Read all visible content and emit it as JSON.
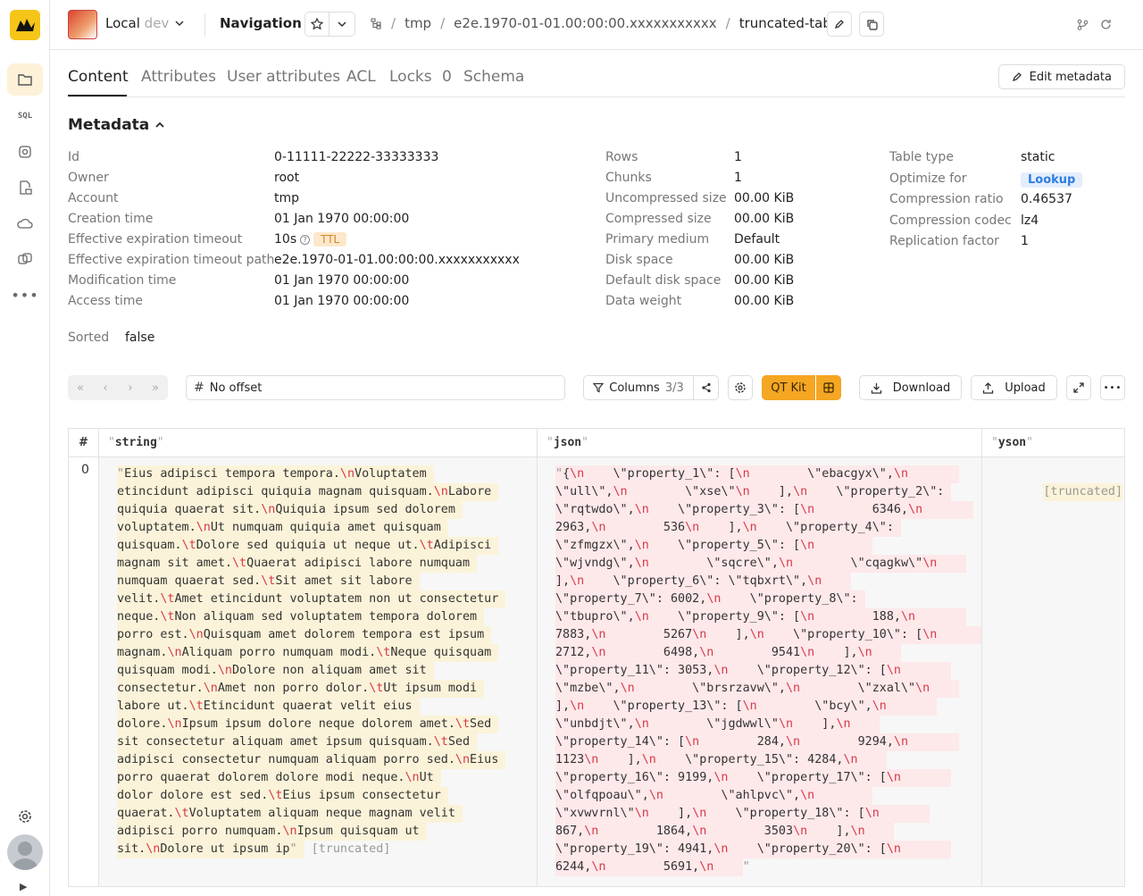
{
  "app": {
    "title": "Navigation"
  },
  "cluster": {
    "name": "Local",
    "env": "dev"
  },
  "breadcrumbs": [
    "tmp",
    "e2e.1970-01-01.00:00:00.xxxxxxxxxxx",
    "truncated-table"
  ],
  "tabs": [
    {
      "label": "Content"
    },
    {
      "label": "Attributes"
    },
    {
      "label": "User attributes"
    },
    {
      "label": "ACL"
    },
    {
      "label": "Locks",
      "count": "0"
    },
    {
      "label": "Schema"
    }
  ],
  "edit_metadata_label": "Edit metadata",
  "metadata": {
    "title": "Metadata",
    "col1": [
      {
        "key": "Id",
        "value": "0-11111-22222-33333333"
      },
      {
        "key": "Owner",
        "value": "root"
      },
      {
        "key": "Account",
        "value": "tmp"
      },
      {
        "key": "Creation time",
        "value": "01 Jan 1970 00:00:00"
      },
      {
        "key": "Effective expiration timeout",
        "value": "10s",
        "badge": "TTL"
      },
      {
        "key": "Effective expiration timeout path",
        "value": "e2e.1970-01-01.00:00:00.xxxxxxxxxxx"
      },
      {
        "key": "Modification time",
        "value": "01 Jan 1970 00:00:00"
      },
      {
        "key": "Access time",
        "value": "01 Jan 1970 00:00:00"
      }
    ],
    "col2": [
      {
        "key": "Rows",
        "value": "1"
      },
      {
        "key": "Chunks",
        "value": "1"
      },
      {
        "key": "Uncompressed size",
        "value": "00.00 KiB"
      },
      {
        "key": "Compressed size",
        "value": "00.00 KiB"
      },
      {
        "key": "Primary medium",
        "value": "Default"
      },
      {
        "key": "Disk space",
        "value": "00.00 KiB"
      },
      {
        "key": "Default disk space",
        "value": "00.00 KiB"
      },
      {
        "key": "Data weight",
        "value": "00.00 KiB"
      }
    ],
    "col3": [
      {
        "key": "Table type",
        "value": "static"
      },
      {
        "key": "Optimize for",
        "value": "Lookup"
      },
      {
        "key": "Compression ratio",
        "value": "0.46537"
      },
      {
        "key": "Compression codec",
        "value": "lz4"
      },
      {
        "key": "Replication factor",
        "value": "1"
      }
    ],
    "sorted": {
      "key": "Sorted",
      "value": "false"
    }
  },
  "toolbar": {
    "offset_label": "No offset",
    "columns_label": "Columns",
    "columns_count": "3/3",
    "qt_kit_label": "QT Kit",
    "download_label": "Download",
    "upload_label": "Upload"
  },
  "table": {
    "columns": [
      "#",
      "string",
      "json",
      "yson"
    ],
    "row_index": "0",
    "string_cell_lines": [
      "Eius adipisci tempora tempora.\\nVoluptatem ",
      "etincidunt adipisci quiquia magnam quisquam.\\nLabore ",
      "quiquia quaerat sit.\\nQuiquia ipsum sed dolorem ",
      "voluptatem.\\nUt numquam quiquia amet quisquam ",
      "quisquam.\\tDolore sed quiquia ut neque ut.\\tAdipisci ",
      "magnam sit amet.\\tQuaerat adipisci labore numquam ",
      "numquam quaerat sed.\\tSit amet sit labore ",
      "velit.\\tAmet etincidunt voluptatem non ut consectetur ",
      "neque.\\tNon aliquam sed voluptatem tempora dolorem ",
      "porro est.\\nQuisquam amet dolorem tempora est ipsum ",
      "magnam.\\nAliquam porro numquam modi.\\tNeque quisquam ",
      "quisquam modi.\\nDolore non aliquam amet sit ",
      "consectetur.\\nAmet non porro dolor.\\tUt ipsum modi ",
      "labore ut.\\tEtincidunt quaerat velit eius ",
      "dolore.\\nIpsum ipsum dolore neque dolorem amet.\\tSed ",
      "sit consectetur aliquam amet ipsum quisquam.\\tSed ",
      "adipisci consectetur numquam aliquam porro sed.\\nEius ",
      "porro quaerat dolorem dolore modi neque.\\nUt ",
      "dolor dolore est sed.\\tEius ipsum consectetur ",
      "quaerat.\\tVoluptatem aliquam neque magnam velit ",
      "adipisci porro numquam.\\nIpsum quisquam ut ",
      "sit.\\nDolore ut ipsum ip"
    ],
    "json_cell_lines": [
      "{\\n    \\\"property_1\\\": [\\n        \\\"ebacgyx\\\",\\n       ",
      "\\\"ull\\\",\\n        \\\"xse\\\"\\n    ],\\n    \\\"property_2\\\": ",
      "\\\"rqtwdo\\\",\\n    \\\"property_3\\\": [\\n        6346,\\n       ",
      "2963,\\n        536\\n    ],\\n    \\\"property_4\\\": ",
      "\\\"zfmgzx\\\",\\n    \\\"property_5\\\": [\\n        ",
      "\\\"wjvndg\\\",\\n        \\\"sqcre\\\",\\n        \\\"cqagkw\\\"\\n    ",
      "],\\n    \\\"property_6\\\": \\\"tqbxrt\\\",\\n    ",
      "\\\"property_7\\\": 6002,\\n    \\\"property_8\\\": ",
      "\\\"tbupro\\\",\\n    \\\"property_9\\\": [\\n        188,\\n       ",
      "7883,\\n        5267\\n    ],\\n    \\\"property_10\\\": [\\n       ",
      "2712,\\n        6498,\\n        9541\\n    ],\\n    ",
      "\\\"property_11\\\": 3053,\\n    \\\"property_12\\\": [\\n       ",
      "\\\"mzbe\\\",\\n        \\\"brsrzavw\\\",\\n        \\\"zxal\\\"\\n    ",
      "],\\n    \\\"property_13\\\": [\\n        \\\"bcy\\\",\\n       ",
      "\\\"unbdjt\\\",\\n        \\\"jgdwwl\\\"\\n    ],\\n    ",
      "\\\"property_14\\\": [\\n        284,\\n        9294,\\n       ",
      "1123\\n    ],\\n    \\\"property_15\\\": 4284,\\n    ",
      "\\\"property_16\\\": 9199,\\n    \\\"property_17\\\": [\\n       ",
      "\\\"olfqpoau\\\",\\n        \\\"ahlpvc\\\",\\n        ",
      "\\\"xvwvrnl\\\"\\n    ],\\n    \\\"property_18\\\": [\\n       ",
      "867,\\n        1864,\\n        3503\\n    ],\\n    ",
      "\\\"property_19\\\": 4941,\\n    \\\"property_20\\\": [\\n       ",
      "6244,\\n        5691,\\n    "
    ],
    "truncated_label": "[truncated]"
  },
  "colors": {
    "accent": "#f5a623",
    "escape": "#d63b4a",
    "lookup": "#2f7de1"
  }
}
